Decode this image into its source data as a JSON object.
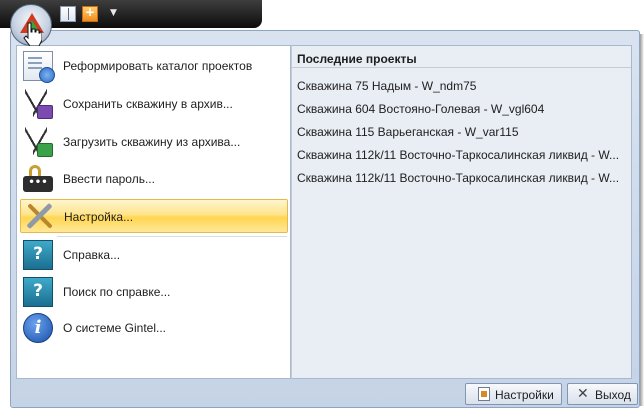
{
  "menu": {
    "items": [
      {
        "label": "Реформировать каталог проектов",
        "icon": "reformat-catalog-icon"
      },
      {
        "label": "Сохранить скважину в архив...",
        "icon": "save-well-archive-icon"
      },
      {
        "label": "Загрузить скважину из архива...",
        "icon": "load-well-archive-icon"
      },
      {
        "label": "Ввести пароль...",
        "icon": "password-lock-icon"
      },
      {
        "label": "Настройка...",
        "icon": "tools-icon",
        "selected": true
      },
      {
        "label": "Справка...",
        "icon": "help-icon"
      },
      {
        "label": "Поиск по справке...",
        "icon": "help-search-icon"
      },
      {
        "label": "О системе Gintel...",
        "icon": "info-icon"
      }
    ]
  },
  "recent": {
    "header": "Последние проекты",
    "items": [
      "Скважина 75 Надым - W_ndm75",
      "Скважина 604 Востояно-Голевая - W_vgl604",
      "Скважина 115 Варьеганская - W_var115",
      "Скважина 112k/11 Восточно-Таркосалинская ликвид - W...",
      "Скважина 112k/11 Восточно-Таркосалинская ликвид - W..."
    ]
  },
  "footer": {
    "settings_label": "Настройки",
    "exit_label": "Выход"
  },
  "colors": {
    "selected_highlight": "#ffd650",
    "menu_frame": "#c5d3e6",
    "recent_pane": "#e9edf4"
  }
}
